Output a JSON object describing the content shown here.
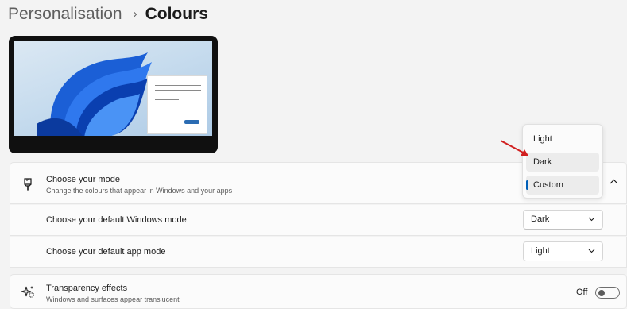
{
  "breadcrumb": {
    "parent": "Personalisation",
    "separator": "›",
    "current": "Colours"
  },
  "preview": {
    "wallpaper": "windows-11-bloom",
    "accent": "#2b6cb3"
  },
  "mode": {
    "icon": "brush-icon",
    "title": "Choose your mode",
    "subtitle": "Change the colours that appear in Windows and your apps",
    "expanded": true,
    "dropdown": {
      "options": [
        "Light",
        "Dark",
        "Custom"
      ],
      "selected": "Custom",
      "hovered": "Dark"
    }
  },
  "windows_mode": {
    "title": "Choose your default Windows mode",
    "value": "Dark"
  },
  "app_mode": {
    "title": "Choose your default app mode",
    "value": "Light"
  },
  "transparency": {
    "icon": "sparkle-icon",
    "title": "Transparency effects",
    "subtitle": "Windows and surfaces appear translucent",
    "state_label": "Off",
    "on": false
  },
  "colors": {
    "accent": "#005fb8",
    "annotation": "#d11f1f"
  }
}
